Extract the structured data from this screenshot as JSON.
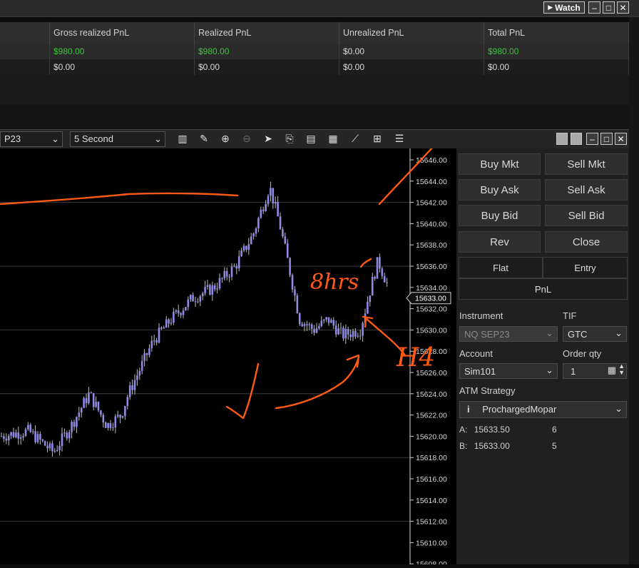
{
  "window": {
    "watch_label": "Watch",
    "min_glyph": "–",
    "max_glyph": "□",
    "close_glyph": "✕"
  },
  "pnl": {
    "headers": [
      "Gross realized PnL",
      "Realized PnL",
      "Unrealized PnL",
      "Total PnL"
    ],
    "rows": [
      [
        "$980.00",
        "$980.00",
        "$0.00",
        "$980.00"
      ],
      [
        "$0.00",
        "$0.00",
        "$0.00",
        "$0.00"
      ]
    ]
  },
  "chart_toolbar": {
    "instrument": "P23",
    "interval": "5 Second"
  },
  "chart": {
    "price_labels": [
      "15646.00",
      "15644.00",
      "15642.00",
      "15640.00",
      "15638.00",
      "15636.00",
      "15634.00",
      "15632.00",
      "15630.00",
      "15628.00",
      "15626.00",
      "15624.00",
      "15622.00",
      "15620.00",
      "15618.00",
      "15616.00",
      "15614.00",
      "15612.00",
      "15610.00",
      "15608.00"
    ],
    "current_price": "15633.00",
    "annotation_8hrs": "8hrs",
    "annotation_h4": "H4",
    "candle_color": "#8f8ae6",
    "annotation_color": "#ff5a14"
  },
  "panel": {
    "buttons": [
      [
        "Buy Mkt",
        "Sell Mkt"
      ],
      [
        "Buy Ask",
        "Sell Ask"
      ],
      [
        "Buy Bid",
        "Sell Bid"
      ],
      [
        "Rev",
        "Close"
      ]
    ],
    "tabs": {
      "flat": "Flat",
      "entry": "Entry",
      "pnl": "PnL"
    },
    "instrument_label": "Instrument",
    "instrument_value": "NQ SEP23",
    "tif_label": "TIF",
    "tif_value": "GTC",
    "account_label": "Account",
    "account_value": "Sim101",
    "order_qty_label": "Order qty",
    "order_qty_value": "1",
    "atm_label": "ATM Strategy",
    "atm_value": "ProchargedMopar",
    "ask_label": "A:",
    "ask_price": "15633.50",
    "ask_size": "6",
    "bid_label": "B:",
    "bid_price": "15633.00",
    "bid_size": "5"
  }
}
